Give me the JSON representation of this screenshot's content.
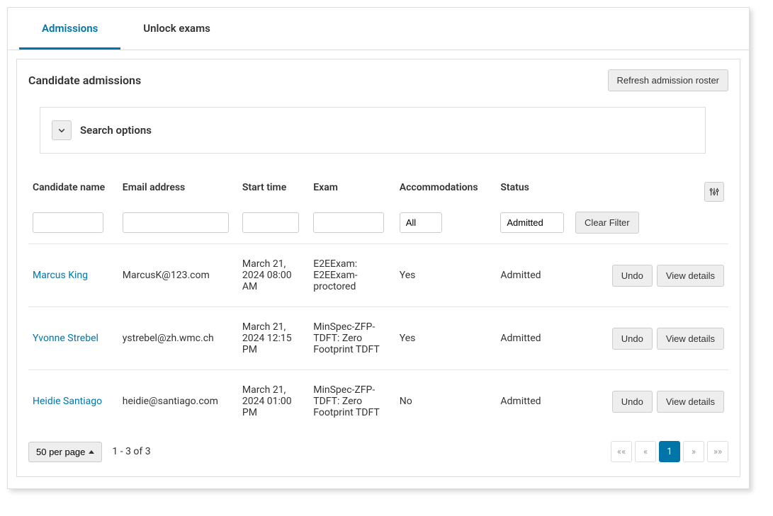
{
  "tabs": [
    {
      "label": "Admissions",
      "active": true
    },
    {
      "label": "Unlock exams",
      "active": false
    }
  ],
  "panel": {
    "title": "Candidate admissions",
    "refresh_label": "Refresh admission roster",
    "search_label": "Search options"
  },
  "columns": {
    "name": "Candidate name",
    "email": "Email address",
    "start": "Start time",
    "exam": "Exam",
    "acc": "Accommodations",
    "status": "Status"
  },
  "filters": {
    "acc_value": "All",
    "status_value": "Admitted",
    "clear_label": "Clear Filter"
  },
  "rows": [
    {
      "name": "Marcus King",
      "email": "MarcusK@123.com",
      "start": "March 21, 2024 08:00 AM",
      "exam": "E2EExam: E2EExam-proctored",
      "acc": "Yes",
      "status": "Admitted"
    },
    {
      "name": "Yvonne Strebel",
      "email": "ystrebel@zh.wmc.ch",
      "start": "March 21, 2024 12:15 PM",
      "exam": "MinSpec-ZFP-TDFT: Zero Footprint TDFT",
      "acc": "Yes",
      "status": "Admitted"
    },
    {
      "name": "Heidie Santiago",
      "email": "heidie@santiago.com",
      "start": "March 21, 2024 01:00 PM",
      "exam": "MinSpec-ZFP-TDFT: Zero Footprint TDFT",
      "acc": "No",
      "status": "Admitted"
    }
  ],
  "actions": {
    "undo": "Undo",
    "details": "View details"
  },
  "footer": {
    "per_page": "50 per page",
    "range": "1 - 3 of 3"
  },
  "pager": {
    "first": "««",
    "prev": "«",
    "page": "1",
    "next": "»",
    "last": "»»"
  }
}
